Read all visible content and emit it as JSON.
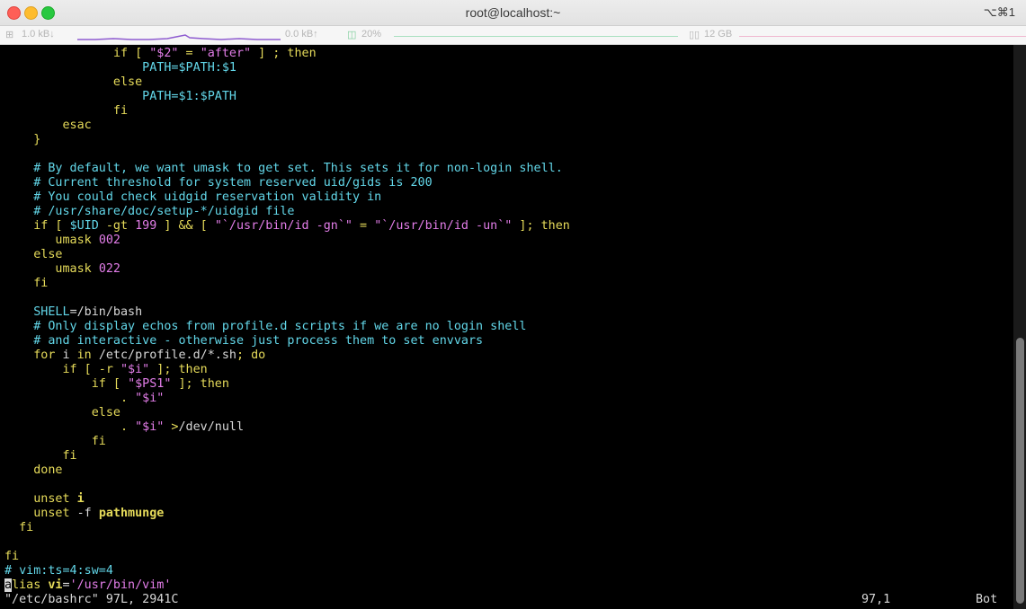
{
  "window": {
    "title": "root@localhost:~",
    "shortcut": "⌥⌘1"
  },
  "status": {
    "download": "1.0 kB↓",
    "upload": "0.0 kB↑",
    "cpu": "20%",
    "memory": "12 GB"
  },
  "editor": {
    "lines": [
      [
        {
          "t": "               "
        },
        {
          "t": "if",
          "c": "y"
        },
        {
          "t": " [ ",
          "c": "y"
        },
        {
          "t": "\"$2\"",
          "c": "m"
        },
        {
          "t": " = ",
          "c": "y"
        },
        {
          "t": "\"after\"",
          "c": "m"
        },
        {
          "t": " ] ; then",
          "c": "y"
        }
      ],
      [
        {
          "t": "                   PATH=$PATH:$1",
          "c": "c"
        }
      ],
      [
        {
          "t": "               else",
          "c": "y"
        }
      ],
      [
        {
          "t": "                   PATH=$1:$PATH",
          "c": "c"
        }
      ],
      [
        {
          "t": "               fi",
          "c": "y"
        }
      ],
      [
        {
          "t": "        esac",
          "c": "y"
        }
      ],
      [
        {
          "t": "    }",
          "c": "y"
        }
      ],
      [
        {
          "t": ""
        }
      ],
      [
        {
          "t": "    # By default, we want umask to get set. This sets it for non-login shell.",
          "c": "c"
        }
      ],
      [
        {
          "t": "    # Current threshold for system reserved uid/gids is 200",
          "c": "c"
        }
      ],
      [
        {
          "t": "    # You could check uidgid reservation validity in",
          "c": "c"
        }
      ],
      [
        {
          "t": "    # /usr/share/doc/setup-*/uidgid file",
          "c": "c"
        }
      ],
      [
        {
          "t": "    if [ ",
          "c": "y"
        },
        {
          "t": "$UID",
          "c": "c"
        },
        {
          "t": " -gt ",
          "c": "y"
        },
        {
          "t": "199",
          "c": "m"
        },
        {
          "t": " ] && [ ",
          "c": "y"
        },
        {
          "t": "\"`/usr/bin/id -gn`\"",
          "c": "m"
        },
        {
          "t": " = ",
          "c": "y"
        },
        {
          "t": "\"`/usr/bin/id -un`\"",
          "c": "m"
        },
        {
          "t": " ]; then",
          "c": "y"
        }
      ],
      [
        {
          "t": "       umask ",
          "c": "y"
        },
        {
          "t": "002",
          "c": "m"
        }
      ],
      [
        {
          "t": "    else",
          "c": "y"
        }
      ],
      [
        {
          "t": "       umask ",
          "c": "y"
        },
        {
          "t": "022",
          "c": "m"
        }
      ],
      [
        {
          "t": "    fi",
          "c": "y"
        }
      ],
      [
        {
          "t": ""
        }
      ],
      [
        {
          "t": "    SHELL",
          "c": "c"
        },
        {
          "t": "=/bin/bash",
          "c": "w"
        }
      ],
      [
        {
          "t": "    # Only display echos from profile.d scripts if we are no login shell",
          "c": "c"
        }
      ],
      [
        {
          "t": "    # and interactive - otherwise just process them to set envvars",
          "c": "c"
        }
      ],
      [
        {
          "t": "    for ",
          "c": "y"
        },
        {
          "t": "i",
          "c": "w"
        },
        {
          "t": " in ",
          "c": "y"
        },
        {
          "t": "/etc/profile.d/*.sh",
          "c": "w"
        },
        {
          "t": "; do",
          "c": "y"
        }
      ],
      [
        {
          "t": "        if [ -r ",
          "c": "y"
        },
        {
          "t": "\"$i\"",
          "c": "m"
        },
        {
          "t": " ]; then",
          "c": "y"
        }
      ],
      [
        {
          "t": "            if [ ",
          "c": "y"
        },
        {
          "t": "\"$PS1\"",
          "c": "m"
        },
        {
          "t": " ]; then",
          "c": "y"
        }
      ],
      [
        {
          "t": "                . ",
          "c": "y"
        },
        {
          "t": "\"$i\"",
          "c": "m"
        }
      ],
      [
        {
          "t": "            else",
          "c": "y"
        }
      ],
      [
        {
          "t": "                . ",
          "c": "y"
        },
        {
          "t": "\"$i\"",
          "c": "m"
        },
        {
          "t": " >",
          "c": "y"
        },
        {
          "t": "/dev/null",
          "c": "w"
        }
      ],
      [
        {
          "t": "            fi",
          "c": "y"
        }
      ],
      [
        {
          "t": "        fi",
          "c": "y"
        }
      ],
      [
        {
          "t": "    done",
          "c": "y"
        }
      ],
      [
        {
          "t": ""
        }
      ],
      [
        {
          "t": "    unset ",
          "c": "y"
        },
        {
          "t": "i",
          "c": "b"
        }
      ],
      [
        {
          "t": "    unset ",
          "c": "y"
        },
        {
          "t": "-f ",
          "c": "w"
        },
        {
          "t": "pathmunge",
          "c": "b"
        }
      ],
      [
        {
          "t": "  fi",
          "c": "y"
        }
      ],
      [
        {
          "t": ""
        }
      ],
      [
        {
          "t": "fi",
          "c": "y"
        }
      ],
      [
        {
          "t": "# vim:ts=4:sw=4",
          "c": "c"
        }
      ],
      [
        {
          "t": "a",
          "c": "cursor"
        },
        {
          "t": "lias ",
          "c": "y"
        },
        {
          "t": "vi",
          "c": "b"
        },
        {
          "t": "=",
          "c": "w"
        },
        {
          "t": "'/usr/bin/vim'",
          "c": "m"
        }
      ]
    ],
    "file_info": "\"/etc/bashrc\" 97L, 2941C",
    "cursor_pos": "97,1",
    "scroll_pos": "Bot"
  }
}
